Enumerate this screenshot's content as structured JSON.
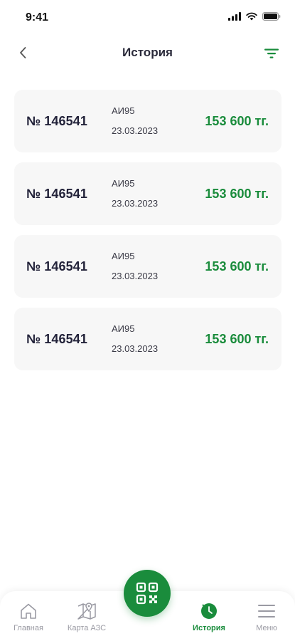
{
  "status_bar": {
    "time": "9:41"
  },
  "header": {
    "title": "История"
  },
  "transactions": [
    {
      "number": "№ 146541",
      "fuel": "АИ95",
      "date": "23.03.2023",
      "amount": "153 600 тг."
    },
    {
      "number": "№ 146541",
      "fuel": "АИ95",
      "date": "23.03.2023",
      "amount": "153 600 тг."
    },
    {
      "number": "№ 146541",
      "fuel": "АИ95",
      "date": "23.03.2023",
      "amount": "153 600 тг."
    },
    {
      "number": "№ 146541",
      "fuel": "АИ95",
      "date": "23.03.2023",
      "amount": "153 600 тг."
    }
  ],
  "bottom_nav": {
    "items": [
      {
        "label": "Главная",
        "icon": "home-icon"
      },
      {
        "label": "Карта АЗС",
        "icon": "map-icon"
      },
      {
        "label": "История",
        "icon": "history-icon",
        "active": true
      },
      {
        "label": "Меню",
        "icon": "menu-icon"
      }
    ],
    "fab_icon": "qr-code-icon"
  },
  "colors": {
    "accent": "#1a8c3c",
    "card_bg": "#f7f7f7",
    "text_dark": "#23233a"
  }
}
